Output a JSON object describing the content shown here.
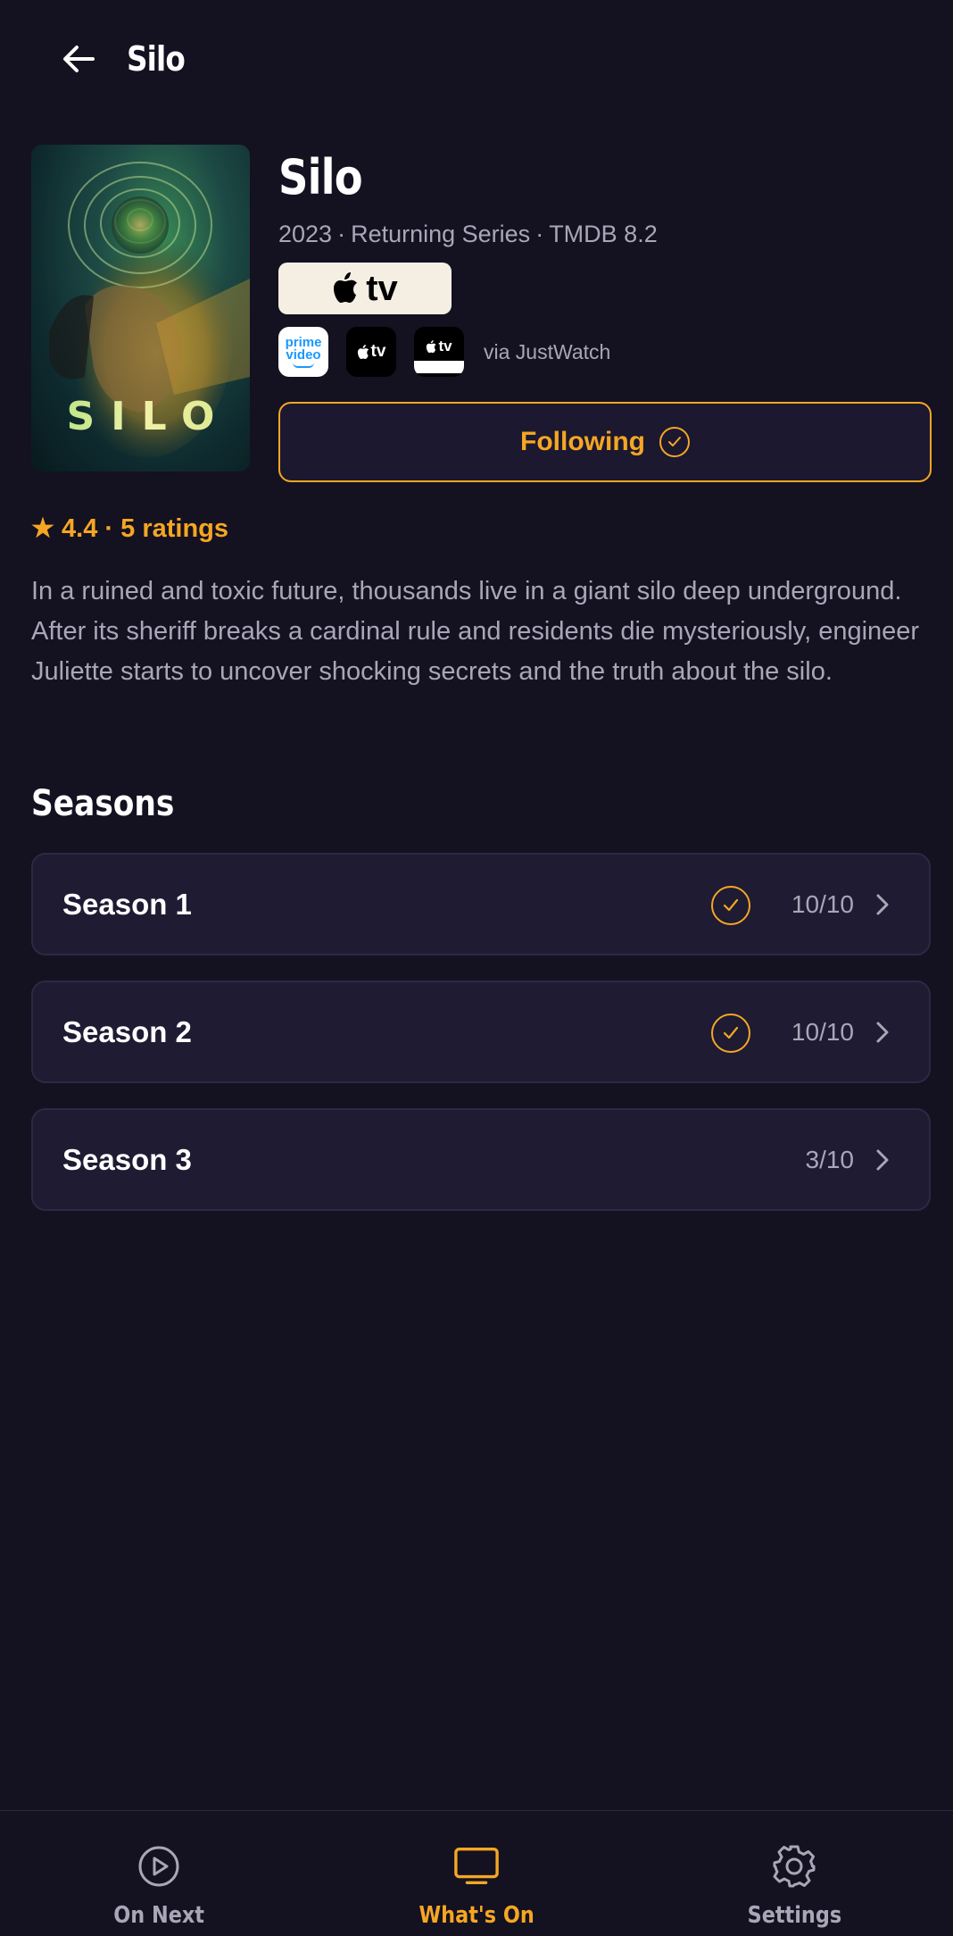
{
  "header": {
    "title": "Silo"
  },
  "show": {
    "poster_title": "SILO",
    "title": "Silo",
    "meta": {
      "year": "2023",
      "status": "Returning Series",
      "score": "TMDB 8.2",
      "separator": "·"
    },
    "primary_provider": {
      "label": "tv",
      "icon": "apple-logo-icon"
    },
    "providers": [
      {
        "name": "Prime Video",
        "label_line1": "prime",
        "label_line2": "video"
      },
      {
        "name": "Apple TV",
        "label": "tv"
      },
      {
        "name": "Apple TV via Prime Video Channels",
        "label": "tv"
      }
    ],
    "via_text": "via JustWatch",
    "follow_label": "Following",
    "rating_text": "★ 4.4 · 5 ratings",
    "description": "In a ruined and toxic future, thousands live in a giant silo deep underground. After its sheriff breaks a cardinal rule and residents die mysteriously, engineer Juliette starts to uncover shocking secrets and the truth about the silo."
  },
  "seasons": {
    "heading": "Seasons",
    "items": [
      {
        "label": "Season 1",
        "count": "10/10",
        "complete": true
      },
      {
        "label": "Season 2",
        "count": "10/10",
        "complete": true
      },
      {
        "label": "Season 3",
        "count": "3/10",
        "complete": false
      }
    ]
  },
  "bottom_nav": {
    "items": [
      {
        "label": "On Next",
        "icon": "play-circle-icon",
        "active": false
      },
      {
        "label": "What's On",
        "icon": "tv-icon",
        "active": true
      },
      {
        "label": "Settings",
        "icon": "gear-icon",
        "active": false
      }
    ]
  },
  "colors": {
    "background": "#141121",
    "accent": "#f5a623",
    "card": "#1e1b33",
    "muted_text": "#a9a6b8"
  }
}
